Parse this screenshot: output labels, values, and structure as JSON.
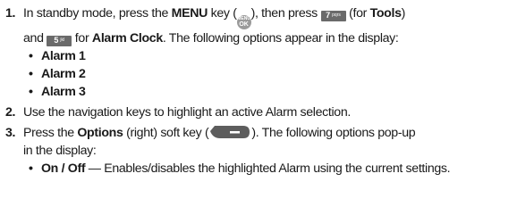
{
  "steps": [
    {
      "num": "1.",
      "t1": "In standby mode, press the ",
      "menu_bold": "MENU",
      "t2": " key (",
      "menu_key_top": "MENU",
      "menu_key_bottom": "OK",
      "t3": "), then press ",
      "key7_digit": "7",
      "key7_sub": "pqrs",
      "t4": " (for ",
      "tools_bold": "Tools",
      "t5": ")",
      "t6": "and ",
      "key5_digit": "5",
      "key5_sub": "jkl",
      "t7": " for ",
      "alarm_clock_bold": "Alarm Clock",
      "t8": ". The following options appear in the display:",
      "bullets": [
        "Alarm 1",
        "Alarm 2",
        "Alarm 3"
      ]
    },
    {
      "num": "2.",
      "text": "Use the navigation keys to highlight an active Alarm selection."
    },
    {
      "num": "3.",
      "t1": "Press the ",
      "options_bold": "Options",
      "t2": " (right) soft key (",
      "t3": "). The following options pop-up",
      "t4": "in the display:",
      "bullet_bold": "On / Off",
      "bullet_text": " — Enables/disables the highlighted Alarm using the current settings."
    }
  ],
  "bullet_char": "•",
  "colors": {
    "text": "#1a1a1a",
    "key_dark": "#6a6a6a",
    "key_round": "#9a9a9a"
  }
}
